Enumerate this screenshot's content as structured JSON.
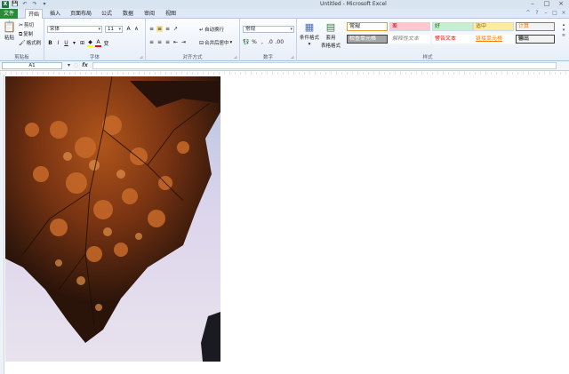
{
  "window": {
    "title": "Untitled - Microsoft Excel",
    "controls": [
      "–",
      "□",
      "×"
    ]
  },
  "quick_access": [
    "X",
    "💾",
    "↶",
    "↷",
    "▾"
  ],
  "tabs": [
    {
      "label": "文件",
      "kind": "file"
    },
    {
      "label": "开始",
      "kind": "active"
    },
    {
      "label": "插入",
      "kind": "normal"
    },
    {
      "label": "页面布局",
      "kind": "normal"
    },
    {
      "label": "公式",
      "kind": "normal"
    },
    {
      "label": "数据",
      "kind": "normal"
    },
    {
      "label": "审阅",
      "kind": "normal"
    },
    {
      "label": "视图",
      "kind": "normal"
    }
  ],
  "ribbon": {
    "clipboard": {
      "label": "剪贴板",
      "paste": "粘贴",
      "cut": "剪切",
      "copy": "复制",
      "format_painter": "格式刷"
    },
    "font": {
      "label": "字体",
      "font_name": "宋体",
      "font_size": "11",
      "bold": "B",
      "italic": "I",
      "underline": "U"
    },
    "alignment": {
      "label": "对齐方式",
      "wrap_text": "自动换行",
      "merge_center": "合并后居中"
    },
    "number": {
      "label": "数字",
      "format": "常规",
      "percent": "%",
      "comma": ","
    },
    "styles": {
      "label": "样式",
      "conditional": "条件格式",
      "table_format_line1": "套用",
      "table_format_line2": "表格格式",
      "cell_styles": [
        {
          "label": "常规",
          "color": "#000000",
          "bg": "#ffffff",
          "border": "#e0a030"
        },
        {
          "label": "差",
          "color": "#9c0006",
          "bg": "#ffc7ce",
          "border": "#cfd9e6"
        },
        {
          "label": "好",
          "color": "#006100",
          "bg": "#c6efce",
          "border": "#cfd9e6"
        },
        {
          "label": "适中",
          "color": "#9c5700",
          "bg": "#ffeb9c",
          "border": "#cfd9e6"
        },
        {
          "label": "计算",
          "color": "#fa7d00",
          "bg": "#f2f2f2",
          "border": "#7f7f7f"
        },
        {
          "label": "检查单元格",
          "color": "#ffffff",
          "bg": "#a5a5a5",
          "border": "#3f3f3f"
        },
        {
          "label": "解释性文本",
          "color": "#7f7f7f",
          "bg": "#ffffff",
          "border": "#ffffff"
        },
        {
          "label": "警告文本",
          "color": "#ff0000",
          "bg": "#ffffff",
          "border": "#ffffff"
        },
        {
          "label": "链接单元格",
          "color": "#fa7d00",
          "bg": "#ffffff",
          "border": "#ffffff"
        },
        {
          "label": "输出",
          "color": "#3f3f3f",
          "bg": "#f2f2f2",
          "border": "#3f3f3f"
        }
      ]
    }
  },
  "formula_bar": {
    "name_box": "A1",
    "fx": "fx",
    "value": ""
  },
  "colors": {
    "file_tab": "#2a8a3c",
    "ribbon_border": "#a9bfd6"
  }
}
